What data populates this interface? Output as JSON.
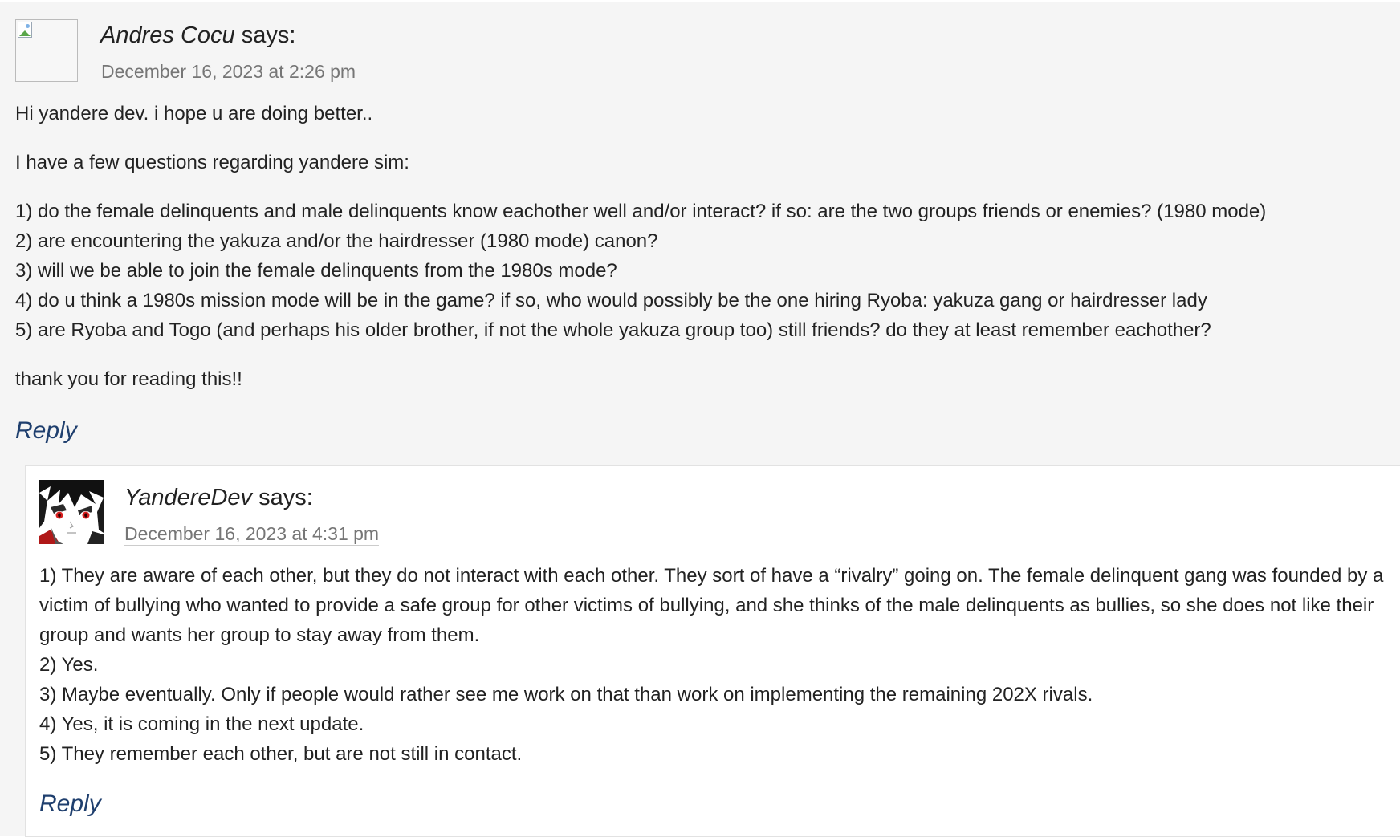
{
  "comment1": {
    "author": "Andres Cocu",
    "says": " says:",
    "date": "December 16, 2023 at 2:26 pm",
    "greeting": "Hi yandere dev. i hope u are doing better..",
    "intro": "I have a few questions regarding yandere sim:",
    "questions": [
      "1) do the female delinquents and male delinquents know eachother well and/or interact? if so: are the two groups friends or enemies? (1980 mode)",
      "2) are encountering the yakuza and/or the hairdresser (1980 mode) canon?",
      "3) will we be able to join the female delinquents from the 1980s mode?",
      "4) do u think a 1980s mission mode will be in the game? if so, who would possibly be the one hiring Ryoba: yakuza gang or hairdresser lady",
      "5) are Ryoba and Togo (and perhaps his older brother, if not the whole yakuza group too) still friends? do they at least remember eachother?"
    ],
    "closing": "thank you for reading this!!",
    "reply_label": "Reply",
    "avatar_icon": "broken-image-icon"
  },
  "comment2": {
    "author": "YandereDev",
    "says": " says:",
    "date": "December 16, 2023 at 4:31 pm",
    "answer1": "1) They are aware of each other, but they do not interact with each other. They sort of have a “rivalry” going on. The female delinquent gang was founded by a victim of bullying who wanted to provide a safe group for other victims of bullying, and she thinks of the male delinquents as bullies, so she does not like their group and wants her group to stay away from them.",
    "answers": [
      "2) Yes.",
      "3) Maybe eventually. Only if people would rather see me work on that than work on implementing the remaining 202X rivals.",
      "4) Yes, it is coming in the next update.",
      "5) They remember each other, but are not still in contact."
    ],
    "reply_label": "Reply",
    "avatar_icon": "anime-avatar-icon"
  },
  "colors": {
    "outer_bg": "#f5f5f5",
    "inner_bg": "#ffffff",
    "link": "#1f3f6e",
    "meta": "#767676",
    "text": "#222222"
  }
}
